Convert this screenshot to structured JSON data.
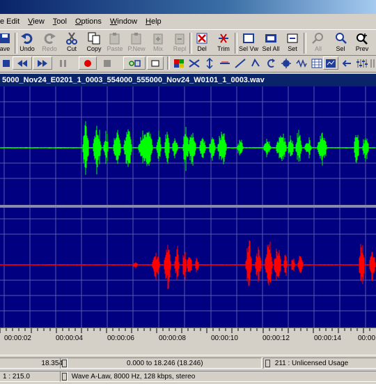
{
  "menu": {
    "items": [
      {
        "pre": "",
        "u": "",
        "post": "e Edit"
      },
      {
        "pre": "",
        "u": "V",
        "post": "iew"
      },
      {
        "pre": "",
        "u": "T",
        "post": "ool"
      },
      {
        "pre": "",
        "u": "O",
        "post": "ptions"
      },
      {
        "pre": "",
        "u": "W",
        "post": "indow"
      },
      {
        "pre": "",
        "u": "H",
        "post": "elp"
      }
    ]
  },
  "toolbar": {
    "buttons": [
      {
        "label": "ave",
        "icon": "save-icon",
        "enabled": true
      },
      {
        "label": "Undo",
        "icon": "undo-icon",
        "enabled": true
      },
      {
        "label": "Redo",
        "icon": "redo-icon",
        "enabled": false
      },
      {
        "label": "Cut",
        "icon": "cut-icon",
        "enabled": true
      },
      {
        "label": "Copy",
        "icon": "copy-icon",
        "enabled": true
      },
      {
        "label": "Paste",
        "icon": "paste-icon",
        "enabled": false
      },
      {
        "label": "P.New",
        "icon": "paste-new-icon",
        "enabled": false
      },
      {
        "label": "Mix",
        "icon": "mix-icon",
        "enabled": false
      },
      {
        "label": "Repl",
        "icon": "replace-icon",
        "enabled": false
      },
      {
        "label": "Del",
        "icon": "delete-icon",
        "enabled": true
      },
      {
        "label": "Trim",
        "icon": "trim-icon",
        "enabled": true
      },
      {
        "label": "Sel Vw",
        "icon": "select-view-icon",
        "enabled": true
      },
      {
        "label": "Sel All",
        "icon": "select-all-icon",
        "enabled": true
      },
      {
        "label": "Set",
        "icon": "set-icon",
        "enabled": true
      },
      {
        "label": "All",
        "icon": "zoom-all-icon",
        "enabled": false
      },
      {
        "label": "Sel",
        "icon": "zoom-selection-icon",
        "enabled": true
      },
      {
        "label": "Prev",
        "icon": "zoom-previous-icon",
        "enabled": true
      }
    ]
  },
  "file": {
    "title": "5000_Nov24_E0201_1_0003_554000_555000_Nov24_W0101_1_0003.wav"
  },
  "timeline": {
    "labels": [
      "00:00:02",
      "00:00:04",
      "00:00:06",
      "00:00:08",
      "00:00:10",
      "00:00:12",
      "00:00:14",
      "00:00:"
    ]
  },
  "status": {
    "length": "18.354",
    "selection": "0.000 to 18.246 (18.246)",
    "license": "211 : Unlicensed Usage",
    "zoom": "1 : 215.0",
    "format": "Wave A-Law, 8000 Hz, 128 kbps, stereo"
  },
  "colors": {
    "waveform_bg": "#000080",
    "channel_left": "#00ff00",
    "channel_right": "#ff0000",
    "title_bar": "#0a246a"
  }
}
